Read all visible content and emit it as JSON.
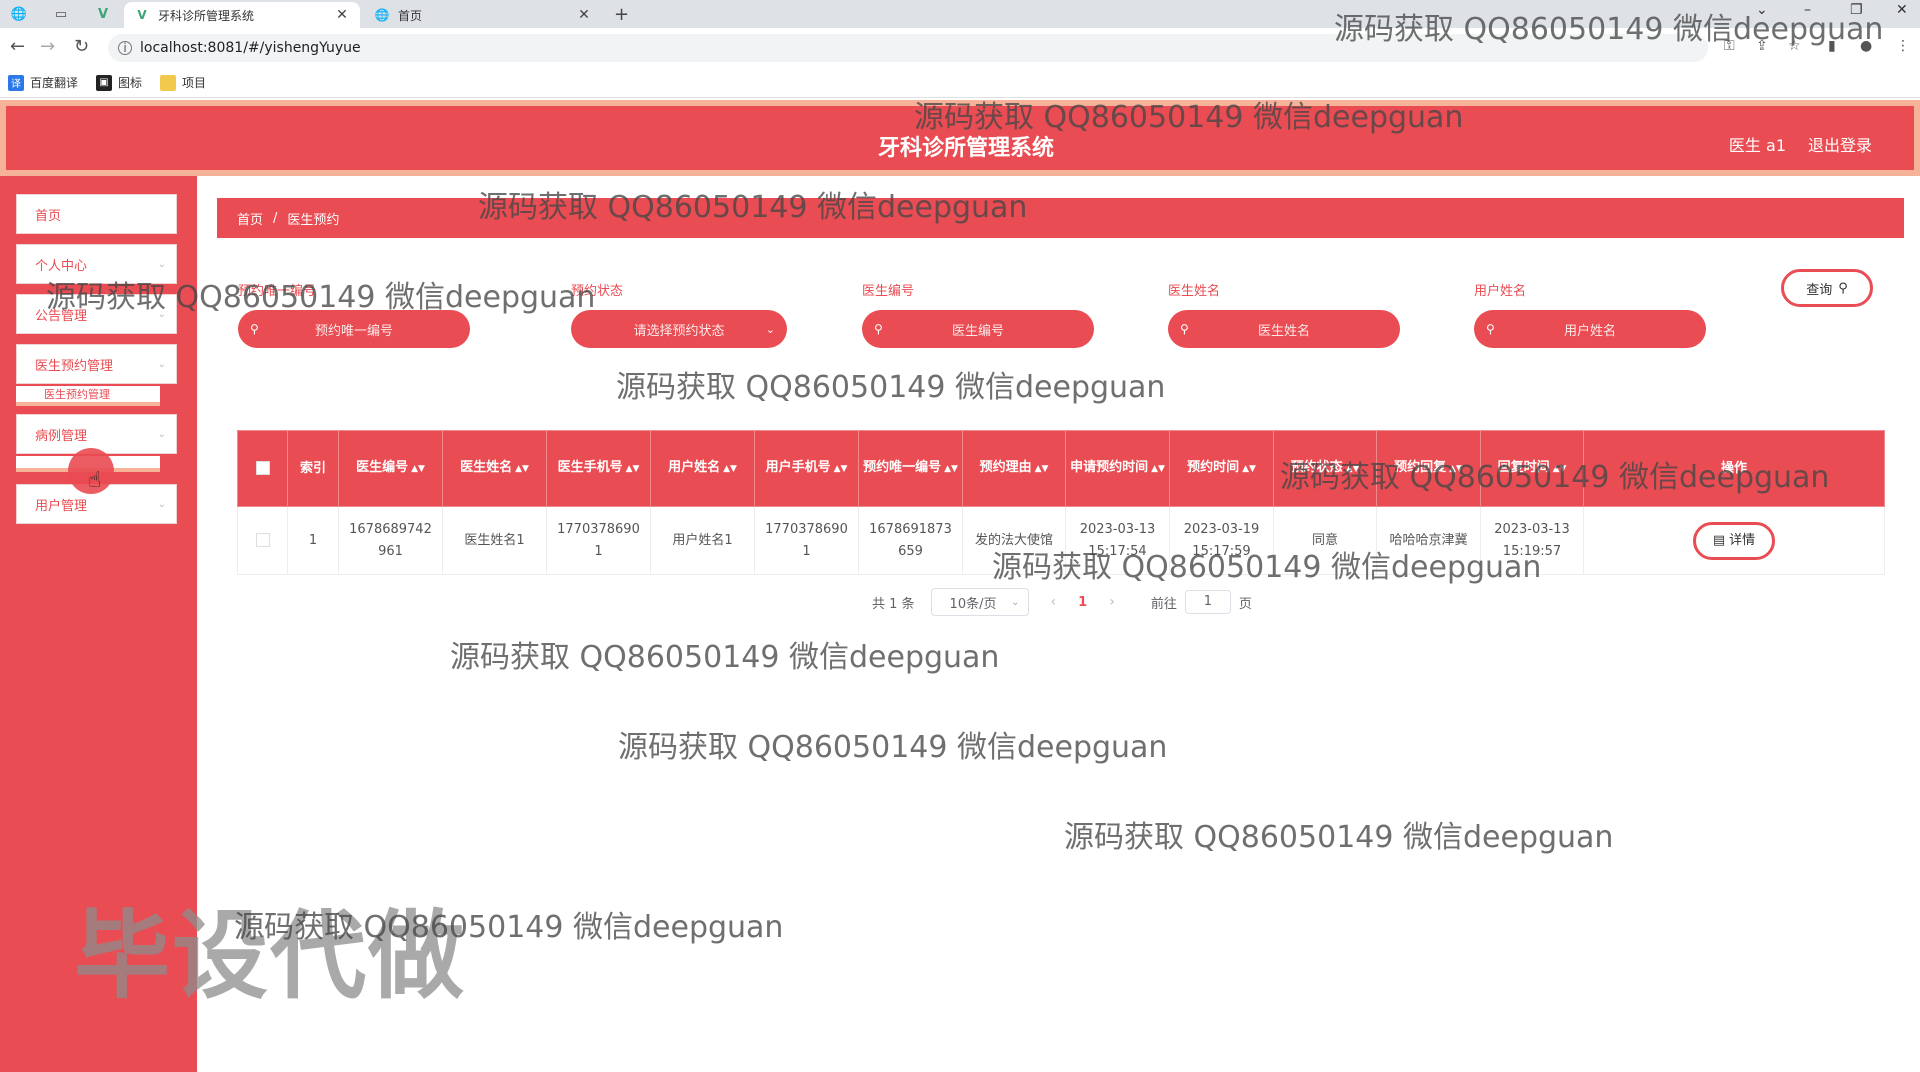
{
  "browser": {
    "tabs": [
      {
        "title": "牙科诊所管理系统",
        "active": true
      },
      {
        "title": "首页",
        "active": false
      }
    ],
    "url": "localhost:8081/#/yishengYuyue",
    "bookmarks": [
      {
        "label": "百度翻译",
        "icon": "translate-icon"
      },
      {
        "label": "图标",
        "icon": "image-icon"
      },
      {
        "label": "项目",
        "icon": "folder-icon"
      }
    ]
  },
  "header": {
    "title": "牙科诊所管理系统",
    "user": "医生 a1",
    "logout": "退出登录"
  },
  "sidebar": {
    "items": [
      {
        "label": "首页"
      },
      {
        "label": "个人中心"
      },
      {
        "label": "公告管理"
      },
      {
        "label": "医生预约管理"
      },
      {
        "label": "病例管理"
      },
      {
        "label": "用户管理"
      }
    ],
    "sub_item": "医生预约管理"
  },
  "breadcrumb": {
    "home": "首页",
    "sep": "/",
    "current": "医生预约"
  },
  "filters": [
    {
      "label": "预约唯一编号",
      "placeholder": "预约唯一编号",
      "type": "input"
    },
    {
      "label": "预约状态",
      "placeholder": "请选择预约状态",
      "type": "select"
    },
    {
      "label": "医生编号",
      "placeholder": "医生编号",
      "type": "input"
    },
    {
      "label": "医生姓名",
      "placeholder": "医生姓名",
      "type": "input"
    },
    {
      "label": "用户姓名",
      "placeholder": "用户姓名",
      "type": "input"
    }
  ],
  "query_button": "查询",
  "table": {
    "columns": [
      "索引",
      "医生编号",
      "医生姓名",
      "医生手机号",
      "用户姓名",
      "用户手机号",
      "预约唯一编号",
      "预约理由",
      "申请预约时间",
      "预约时间",
      "预约状态",
      "预约回复",
      "回复时间",
      "操作"
    ],
    "rows": [
      {
        "index": "1",
        "doctor_no": "1678689742961",
        "doctor_name": "医生姓名1",
        "doctor_phone": "17703786901",
        "user_name": "用户姓名1",
        "user_phone": "17703786901",
        "booking_no": "1678691873659",
        "reason": "发的法大使馆",
        "apply_time": "2023-03-13 15:17:54",
        "booking_time": "2023-03-19 15:17:59",
        "status": "同意",
        "reply": "哈哈哈京津冀",
        "reply_time": "2023-03-13 15:19:57",
        "action": "详情"
      }
    ]
  },
  "pagination": {
    "total": "共 1 条",
    "page_size": "10条/页",
    "current": "1",
    "goto_label": "前往",
    "goto_value": "1",
    "page_suffix": "页"
  },
  "watermark": {
    "text": "源码获取 QQ86050149 微信deepguan",
    "big": "毕设代做"
  },
  "colors": {
    "accent": "#e94c52",
    "header_border": "#f6b39a"
  }
}
